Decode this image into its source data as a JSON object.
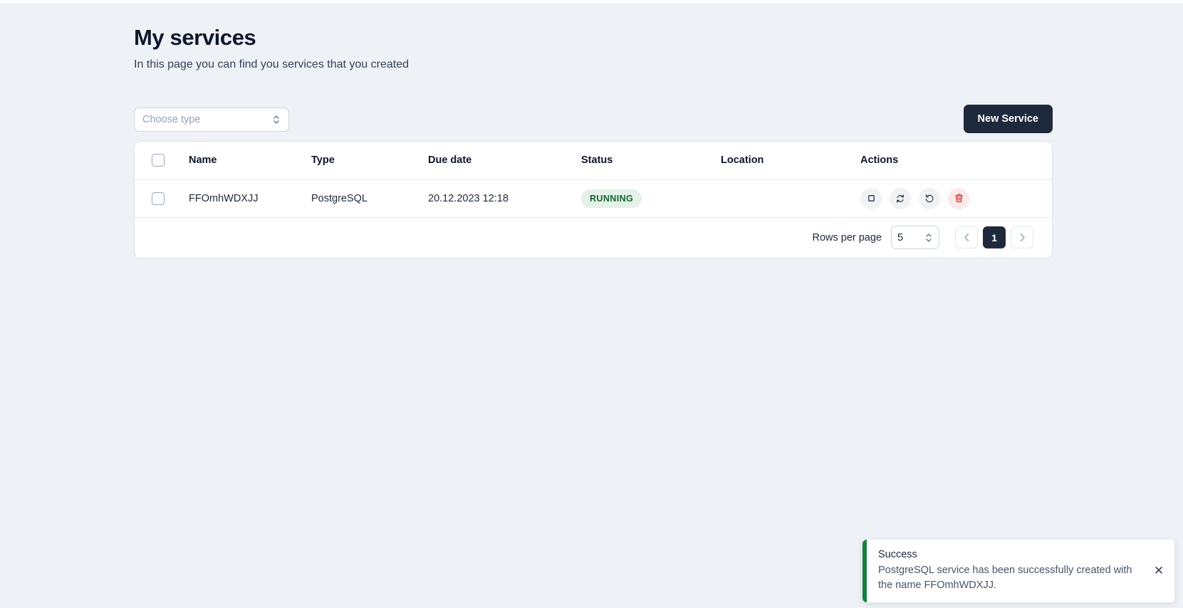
{
  "header": {
    "title": "My services",
    "subtitle": "In this page you can find you services that you created"
  },
  "toolbar": {
    "type_filter": {
      "placeholder": "Choose type",
      "value": "",
      "icon": "chevron-up-down-icon"
    },
    "new_service_label": "New Service"
  },
  "table": {
    "columns": [
      "Name",
      "Type",
      "Due date",
      "Status",
      "Location",
      "Actions"
    ],
    "rows": [
      {
        "name": "FFOmhWDXJJ",
        "type": "PostgreSQL",
        "due_date": "20.12.2023 12:18",
        "status": "RUNNING",
        "location": "",
        "actions": [
          "stop-icon",
          "restart-icon",
          "reload-icon",
          "delete-icon"
        ]
      }
    ],
    "status_colors": {
      "running_text": "#166534",
      "running_bg": "#e3f1e7"
    }
  },
  "footer": {
    "rows_per_page_label": "Rows per page",
    "rows_per_page_value": "5",
    "prev_label": "‹",
    "next_label": "›",
    "pages": [
      "1"
    ],
    "current_page": "1"
  },
  "toast": {
    "title": "Success",
    "message": "PostgreSQL service has been successfully created with the name FFOmhWDXJJ.",
    "accent_color": "#15803d",
    "close_label": "✕"
  }
}
